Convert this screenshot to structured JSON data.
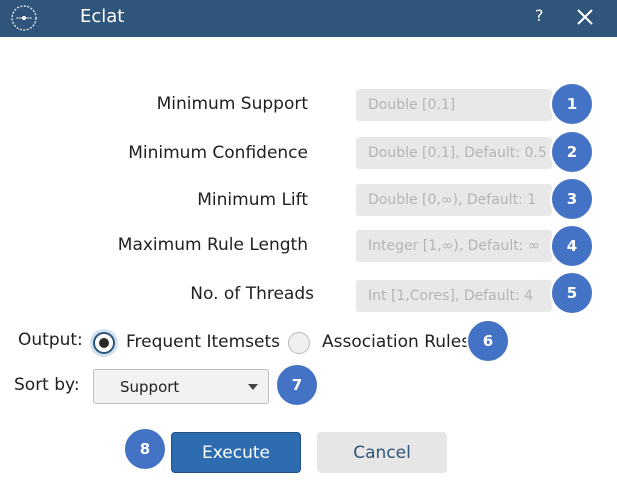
{
  "window": {
    "title": "Eclat",
    "help_label": "?",
    "logo_icon": "app-logo-icon",
    "close_icon": "close-icon"
  },
  "params": [
    {
      "label": "Minimum Support",
      "placeholder": "Double [0,1]",
      "badge": "1"
    },
    {
      "label": "Minimum Confidence",
      "placeholder": "Double [0,1], Default: 0.5",
      "badge": "2"
    },
    {
      "label": "Minimum Lift",
      "placeholder": "Double [0,∞), Default: 1",
      "badge": "3"
    },
    {
      "label": "Maximum Rule Length",
      "placeholder": "Integer [1,∞), Default: ∞",
      "badge": "4"
    },
    {
      "label": "No. of Threads",
      "placeholder": "Int [1,Cores], Default: 4",
      "badge": "5"
    }
  ],
  "output": {
    "label": "Output:",
    "options": [
      {
        "label": "Frequent Itemsets",
        "selected": true
      },
      {
        "label": "Association Rules",
        "selected": false
      }
    ],
    "badge": "6"
  },
  "sort": {
    "label": "Sort by:",
    "value": "Support",
    "badge": "7"
  },
  "actions": {
    "execute_label": "Execute",
    "cancel_label": "Cancel",
    "badge": "8"
  },
  "colors": {
    "titlebar": "#2f557a",
    "badge": "#4472c4",
    "execute_bg": "#2e6cb0",
    "field_bg": "#e8e8e8"
  }
}
